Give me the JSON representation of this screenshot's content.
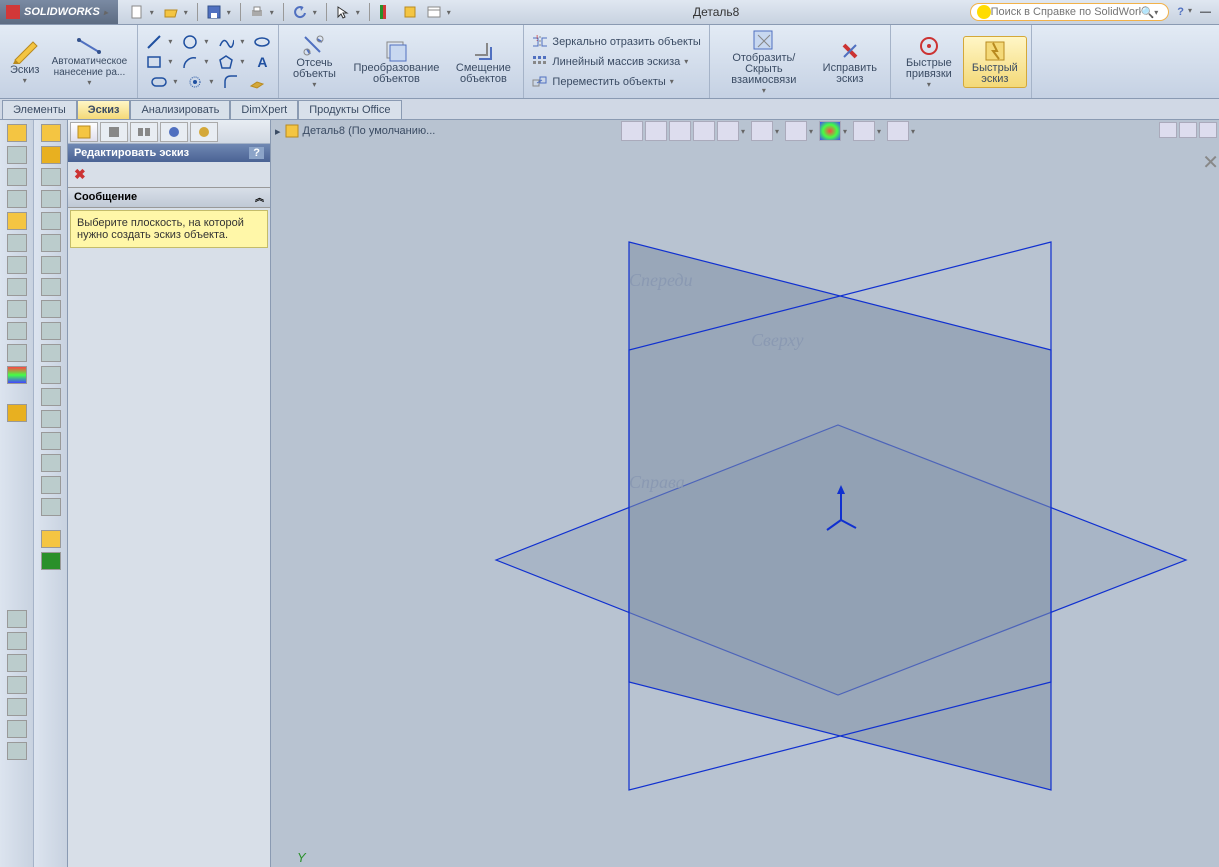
{
  "app_name": "SOLIDWORKS",
  "document_title": "Деталь8",
  "search_placeholder": "Поиск в Справке по SolidWorks",
  "ribbon": {
    "sketch_btn": "Эскиз",
    "auto_dim": "Автоматическое нанесение ра...",
    "cut": "Отсечь объекты",
    "transform": "Преобразование объектов",
    "offset": "Смещение объектов",
    "mirror": "Зеркально отразить объекты",
    "linear": "Линейный массив эскиза",
    "move": "Переместить объекты",
    "show_hide": "Отобразить/Скрыть взаимосвязи",
    "repair": "Исправить эскиз",
    "quick_snap": "Быстрые привязки",
    "quick_sketch": "Быстрый эскиз"
  },
  "tabs": {
    "elements": "Элементы",
    "sketch": "Эскиз",
    "analyze": "Анализировать",
    "dimxpert": "DimXpert",
    "office": "Продукты Office"
  },
  "prop": {
    "title": "Редактировать эскиз",
    "q": "?",
    "msg_header": "Сообщение",
    "msg_body": "Выберите плоскость, на которой нужно создать эскиз объекта."
  },
  "crumb": "Деталь8  (По умолчанию...",
  "planes": {
    "front": "Спереди",
    "top": "Сверху",
    "right": "Справа"
  },
  "axis_y": "Y"
}
